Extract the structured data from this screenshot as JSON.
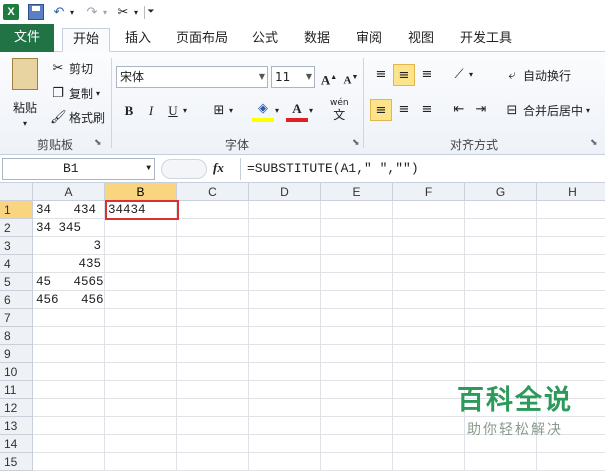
{
  "quick_access": {
    "app_logo": "X",
    "undo_icon": "undo-icon",
    "redo_icon": "redo-icon",
    "customize_icon": "customize-icon"
  },
  "tabs": {
    "file": "文件",
    "items": [
      "开始",
      "插入",
      "页面布局",
      "公式",
      "数据",
      "审阅",
      "视图",
      "开发工具"
    ],
    "active_index": 0
  },
  "ribbon": {
    "clipboard": {
      "paste": "粘贴",
      "cut": "剪切",
      "copy": "复制",
      "format_painter": "格式刷",
      "label": "剪贴板"
    },
    "font": {
      "font_name": "宋体",
      "font_size": "11",
      "bold": "B",
      "italic": "I",
      "underline": "U",
      "grow": "A",
      "shrink": "A",
      "wen": "wén",
      "wen_char": "文",
      "label": "字体"
    },
    "alignment": {
      "wrap_text": "自动换行",
      "merge_center": "合并后居中",
      "label": "对齐方式"
    }
  },
  "formula_bar": {
    "name_box": "B1",
    "fx": "fx",
    "formula": "=SUBSTITUTE(A1,\" \",\"\")"
  },
  "sheet": {
    "columns": [
      "A",
      "B",
      "C",
      "D",
      "E",
      "F",
      "G",
      "H"
    ],
    "selected_column": "B",
    "rows": [
      "1",
      "2",
      "3",
      "4",
      "5",
      "6",
      "7",
      "8",
      "9",
      "10",
      "11",
      "12",
      "13",
      "14",
      "15"
    ],
    "selected_row": "1",
    "cells": {
      "A1": "34   434",
      "A2": "34 345",
      "A3": "3",
      "A4": "435",
      "A5": "45   4565",
      "A6": "456   456",
      "B1": "34434"
    }
  },
  "watermark": {
    "title": "百科全说",
    "subtitle": "助你轻松解决"
  },
  "colors": {
    "file_tab": "#217346",
    "selection_border": "#d93030",
    "header_selected": "#f9d57f",
    "watermark_green": "#2c9a5a"
  }
}
